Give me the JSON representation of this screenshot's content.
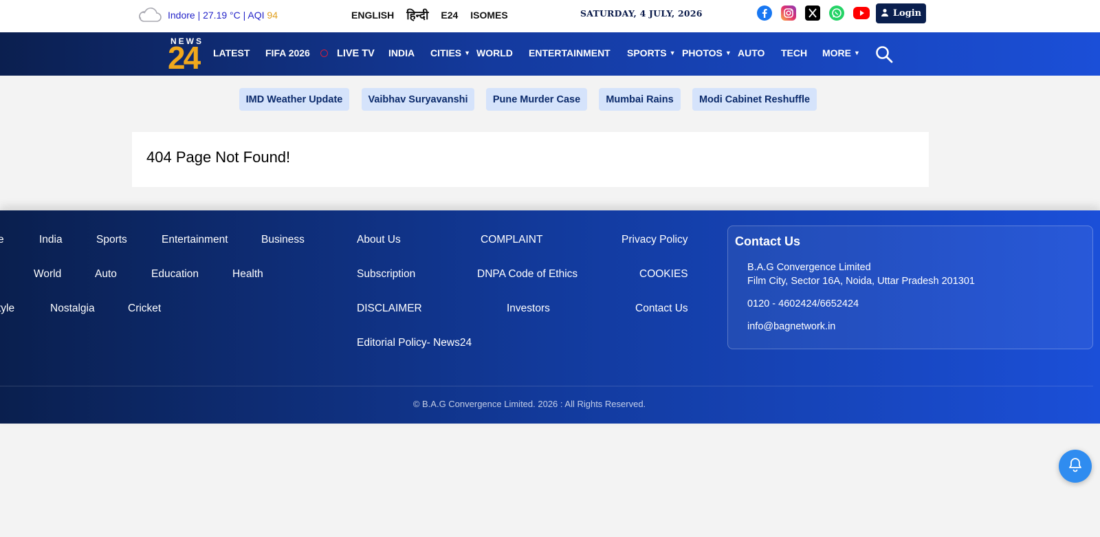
{
  "weather": {
    "location_temp": "Indore | 27.19 °C | AQI ",
    "aqi_value": "94",
    "icon": "cloud-icon"
  },
  "languages": [
    "ENGLISH",
    "हिन्दी",
    "E24",
    "ISOMES"
  ],
  "date": "SATURDAY, 4 JULY, 2026",
  "socials": [
    "facebook-icon",
    "instagram-icon",
    "x-icon",
    "whatsapp-icon",
    "youtube-icon"
  ],
  "login_label": "Login",
  "logo": {
    "top": "NEWS",
    "number": "24"
  },
  "nav": [
    {
      "label": "LATEST"
    },
    {
      "label": "FIFA 2026"
    },
    {
      "label": "LIVE TV"
    },
    {
      "label": "INDIA"
    },
    {
      "label": "CITIES",
      "dropdown": true
    },
    {
      "label": "WORLD"
    },
    {
      "label": "ENTERTAINMENT"
    },
    {
      "label": "SPORTS",
      "dropdown": true
    },
    {
      "label": "PHOTOS",
      "dropdown": true
    },
    {
      "label": "AUTO"
    },
    {
      "label": "TECH"
    },
    {
      "label": "MORE",
      "dropdown": true
    }
  ],
  "trending": [
    "IMD Weather Update",
    "Vaibhav Suryavanshi",
    "Pune Murder Case",
    "Mumbai Rains",
    "Modi Cabinet Reshuffle"
  ],
  "error_message": "404 Page Not Found!",
  "footer": {
    "categories": [
      [
        "e",
        "India",
        "Sports",
        "Entertainment",
        "Business"
      ],
      [
        "World",
        "Auto",
        "Education",
        "Health"
      ],
      [
        "tyle",
        "Nostalgia",
        "Cricket"
      ]
    ],
    "links": [
      [
        "About Us",
        "COMPLAINT",
        "Privacy Policy"
      ],
      [
        "Subscription",
        "DNPA Code of Ethics",
        "COOKIES"
      ],
      [
        "DISCLAIMER",
        "Investors",
        "Contact Us"
      ],
      [
        "Editorial Policy- News24"
      ]
    ],
    "contact": {
      "title": "Contact Us",
      "company": "B.A.G Convergence Limited",
      "address": "Film City, Sector 16A, Noida, Uttar Pradesh 201301",
      "phone": "0120 - 4602424/6652424",
      "email": "info@bagnetwork.in"
    },
    "copyright": "© B.A.G Convergence Limited. 2026 : All Rights Reserved."
  },
  "colors": {
    "accent": "#1b4fd8",
    "navy": "#0a1f4e",
    "logo_gold": "#f0a81c",
    "pill_bg": "#d5e3fb"
  }
}
